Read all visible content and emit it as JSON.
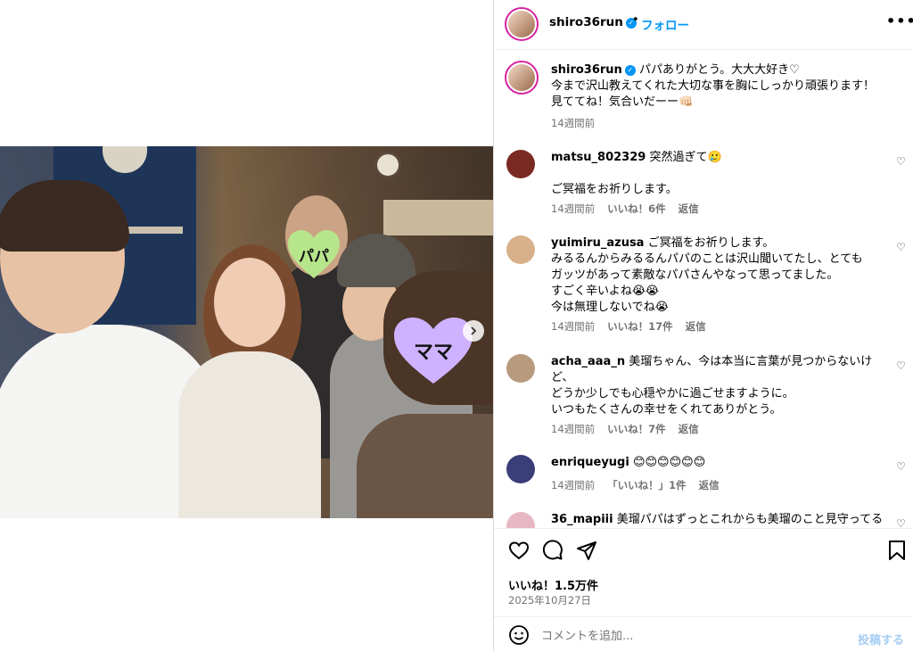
{
  "post": {
    "username": "shiro36run",
    "follow_label": "フォロー",
    "dot": "•",
    "more_icon": "more-horizontal-icon"
  },
  "caption": {
    "username": "shiro36run",
    "text_lines": [
      "パパありがとう。大大大好き♡",
      "今まで沢山教えてくれた大切な事を胸にしっかり頑張ります！",
      "見ててね！気合いだーー👊🏻"
    ],
    "time": "14週間前"
  },
  "photo": {
    "sticker_papa": "パパ",
    "sticker_mama": "ママ"
  },
  "comments": [
    {
      "username": "matsu_802329",
      "text": "突然過ぎて🥲",
      "text2": "ご冥福をお祈りします。",
      "time": "14週間前",
      "likes": "いいね！6件",
      "reply": "返信",
      "avatar_color": "#7a2a22"
    },
    {
      "username": "yuimiru_azusa",
      "text": "ご冥福をお祈りします。",
      "lines": [
        "みるるんからみるるんパパのことは沢山聞いてたし、とても",
        "ガッツがあって素敵なパパさんやなって思ってました。",
        "すごく辛いよね😭😭",
        "今は無理しないでね😭"
      ],
      "time": "14週間前",
      "likes": "いいね！17件",
      "reply": "返信",
      "avatar_color": "#d8b08a"
    },
    {
      "username": "acha_aaa_n",
      "text": "美瑠ちゃん、今は本当に言葉が見つからないけ",
      "lines": [
        "ど、",
        "どうか少しでも心穏やかに過ごせますように。",
        "いつもたくさんの幸せをくれてありがとう。"
      ],
      "time": "14週間前",
      "likes": "いいね！7件",
      "reply": "返信",
      "avatar_color": "#b89a7e"
    },
    {
      "username": "enriqueyugi",
      "text": "😊😊😊😊😊😊",
      "time": "14週間前",
      "likes": "「いいね！」1件",
      "reply": "返信",
      "avatar_color": "#3a3f7a"
    },
    {
      "username": "36_mapiii",
      "text": "美瑠パパはずっとこれからも美瑠のこと見守ってる",
      "avatar_color": "#e7b7c4"
    }
  ],
  "actions": {
    "like_icon": "heart-icon",
    "comment_icon": "comment-icon",
    "share_icon": "send-icon",
    "save_icon": "bookmark-icon",
    "likes": "いいね！1.5万件",
    "date": "2025年10月27日"
  },
  "composer": {
    "placeholder": "コメントを追加...",
    "post_label": "投稿する",
    "emoji_icon": "emoji-icon"
  },
  "colors": {
    "accent": "#0095f6",
    "papa_heart": "#b7e58b",
    "mama_heart": "#cfb2ff"
  }
}
